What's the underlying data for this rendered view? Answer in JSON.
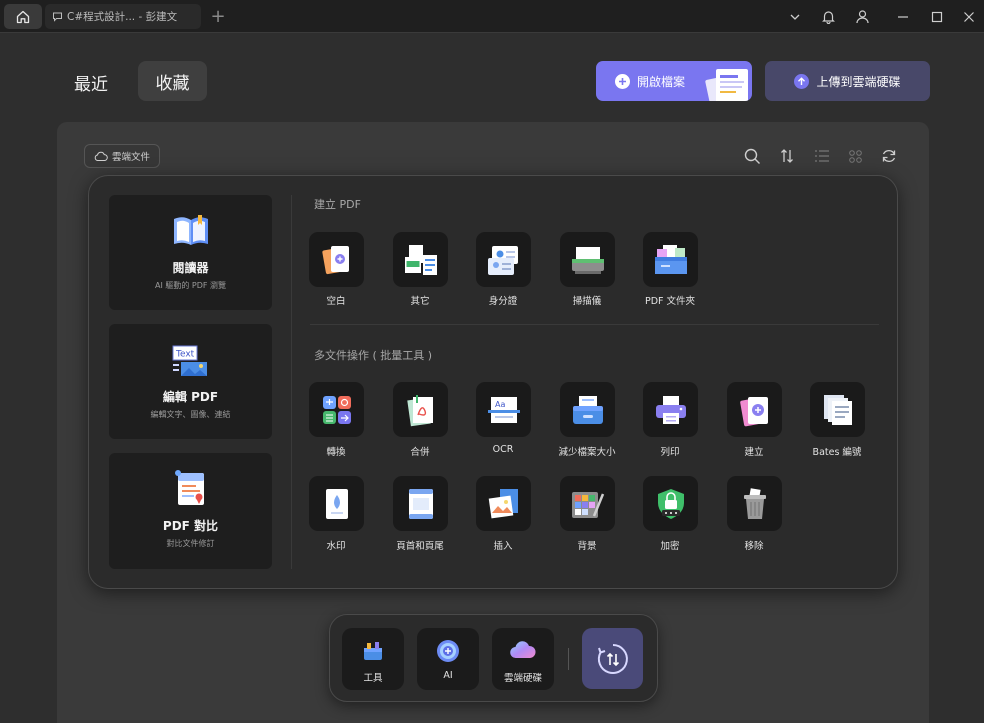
{
  "titlebar": {
    "doc_tab_label": "C#程式設計... - 彭建文"
  },
  "header": {
    "tab_recent": "最近",
    "tab_favorites": "收藏",
    "open_file_label": "開啟檔案",
    "upload_cloud_label": "上傳到雲端硬碟"
  },
  "toolbar": {
    "cloud_docs_label": "雲端文件"
  },
  "feature_cards": [
    {
      "title": "閱讀器",
      "subtitle": "AI 驅動的 PDF 瀏覽",
      "icon": "book-icon"
    },
    {
      "title": "編輯 PDF",
      "subtitle": "編輯文字、圖像、連結",
      "icon": "edit-text-icon"
    },
    {
      "title": "PDF 對比",
      "subtitle": "對比文件修訂",
      "icon": "compare-icon"
    }
  ],
  "create_pdf": {
    "section_title": "建立 PDF",
    "items": [
      {
        "label": "空白",
        "icon": "blank-page-icon"
      },
      {
        "label": "其它",
        "icon": "other-files-icon"
      },
      {
        "label": "身分證",
        "icon": "id-card-icon"
      },
      {
        "label": "掃描儀",
        "icon": "scanner-icon"
      },
      {
        "label": "PDF 文件夾",
        "icon": "pdf-folder-icon"
      }
    ]
  },
  "batch_tools": {
    "section_title": "多文件操作 ( 批量工具 )",
    "items": [
      {
        "label": "轉換",
        "icon": "convert-icon"
      },
      {
        "label": "合併",
        "icon": "merge-icon"
      },
      {
        "label": "OCR",
        "icon": "ocr-icon"
      },
      {
        "label": "減少檔案大小",
        "icon": "compress-icon"
      },
      {
        "label": "列印",
        "icon": "print-icon"
      },
      {
        "label": "建立",
        "icon": "create-icon"
      },
      {
        "label": "Bates 編號",
        "icon": "bates-numbering-icon"
      },
      {
        "label": "水印",
        "icon": "watermark-icon"
      },
      {
        "label": "頁首和頁尾",
        "icon": "header-footer-icon"
      },
      {
        "label": "插入",
        "icon": "insert-icon"
      },
      {
        "label": "背景",
        "icon": "background-icon"
      },
      {
        "label": "加密",
        "icon": "encrypt-icon"
      },
      {
        "label": "移除",
        "icon": "remove-icon"
      }
    ]
  },
  "dock": {
    "items": [
      {
        "label": "工具",
        "icon": "toolbox-icon"
      },
      {
        "label": "AI",
        "icon": "ai-icon"
      },
      {
        "label": "雲端硬碟",
        "icon": "cloud-drive-icon"
      }
    ]
  },
  "colors": {
    "accent": "#7a76f0",
    "upload_button": "#484869",
    "dock_active": "#4a4a79"
  }
}
